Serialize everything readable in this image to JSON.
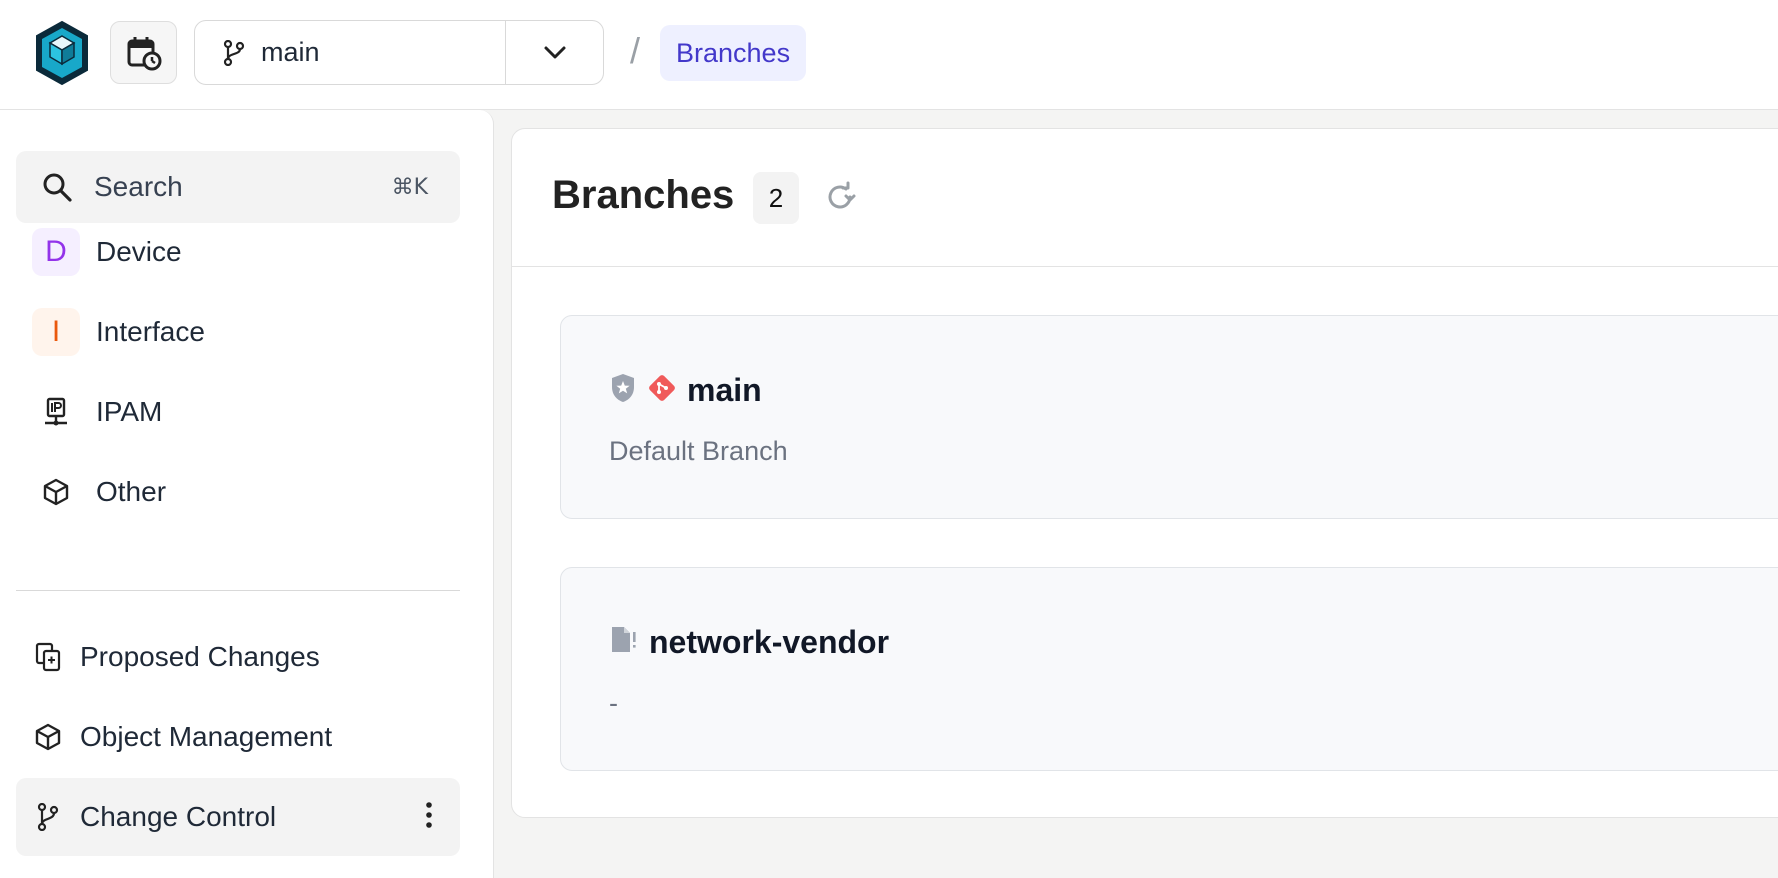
{
  "topbar": {
    "branch_selector": {
      "value": "main"
    },
    "breadcrumb": {
      "separator": "/",
      "current": "Branches"
    }
  },
  "sidebar": {
    "search": {
      "label": "Search",
      "shortcut": "⌘K"
    },
    "menu": [
      {
        "badge": "D",
        "badge_color": "#9333ea",
        "badge_bg": "#f5efff",
        "label": "Device"
      },
      {
        "badge": "I",
        "badge_color": "#ea580c",
        "badge_bg": "#fff4ec",
        "label": "Interface"
      },
      {
        "icon": "ip-network-icon",
        "label": "IPAM"
      },
      {
        "icon": "cube-icon",
        "label": "Other"
      }
    ],
    "sections": [
      {
        "icon": "proposed-changes-icon",
        "label": "Proposed Changes"
      },
      {
        "icon": "cube-icon",
        "label": "Object Management"
      },
      {
        "icon": "git-branch-icon",
        "label": "Change Control",
        "active": true
      }
    ]
  },
  "main": {
    "title": "Branches",
    "count": "2",
    "branches": [
      {
        "name": "main",
        "description": "Default Branch",
        "icons": [
          "shield-star-icon",
          "git-diamond-icon"
        ]
      },
      {
        "name": "network-vendor",
        "description": "-",
        "icons": [
          "file-alert-icon"
        ]
      }
    ]
  },
  "colors": {
    "accent": "#4338ca",
    "accent_bg": "#eef0ff",
    "git_red": "#f05a5a",
    "muted": "#9aa0a6"
  }
}
